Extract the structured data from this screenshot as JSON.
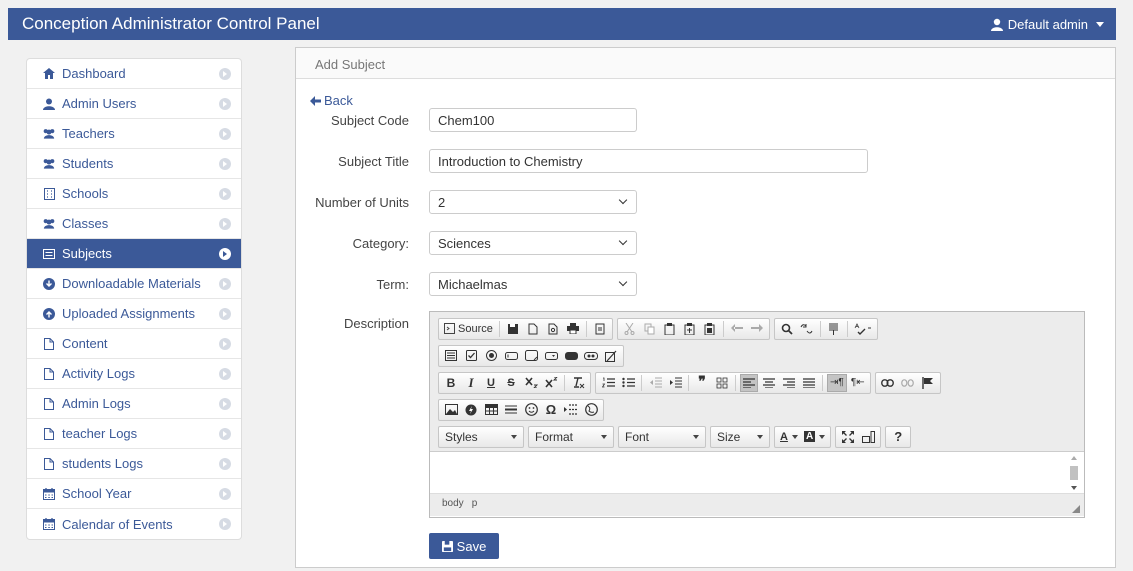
{
  "header": {
    "title": "Conception Administrator Control Panel",
    "user_label": "Default admin"
  },
  "sidebar": {
    "items": [
      {
        "label": "Dashboard",
        "icon": "home-icon"
      },
      {
        "label": "Admin Users",
        "icon": "user-icon"
      },
      {
        "label": "Teachers",
        "icon": "users-icon"
      },
      {
        "label": "Students",
        "icon": "users-icon"
      },
      {
        "label": "Schools",
        "icon": "building-icon"
      },
      {
        "label": "Classes",
        "icon": "users-icon"
      },
      {
        "label": "Subjects",
        "icon": "list-icon",
        "active": true
      },
      {
        "label": "Downloadable Materials",
        "icon": "download-icon"
      },
      {
        "label": "Uploaded Assignments",
        "icon": "upload-icon"
      },
      {
        "label": "Content",
        "icon": "file-icon"
      },
      {
        "label": "Activity Logs",
        "icon": "file-icon"
      },
      {
        "label": "Admin Logs",
        "icon": "file-icon"
      },
      {
        "label": "teacher Logs",
        "icon": "file-icon"
      },
      {
        "label": "students Logs",
        "icon": "file-icon"
      },
      {
        "label": "School Year",
        "icon": "calendar-icon"
      },
      {
        "label": "Calendar of Events",
        "icon": "calendar-icon"
      }
    ]
  },
  "panel": {
    "title": "Add Subject",
    "back_label": "Back"
  },
  "form": {
    "subject_code": {
      "label": "Subject Code",
      "value": "Chem100"
    },
    "subject_title": {
      "label": "Subject Title",
      "value": "Introduction to Chemistry"
    },
    "units": {
      "label": "Number of Units",
      "value": "2"
    },
    "category": {
      "label": "Category:",
      "value": "Sciences"
    },
    "term": {
      "label": "Term:",
      "value": "Michaelmas"
    },
    "description": {
      "label": "Description"
    },
    "save_label": "Save"
  },
  "editor": {
    "source_label": "Source",
    "styles_label": "Styles",
    "format_label": "Format",
    "font_label": "Font",
    "size_label": "Size",
    "status_path": [
      "body",
      "p"
    ]
  },
  "colors": {
    "brand": "#3b5998",
    "active_item": "#3b5998"
  }
}
